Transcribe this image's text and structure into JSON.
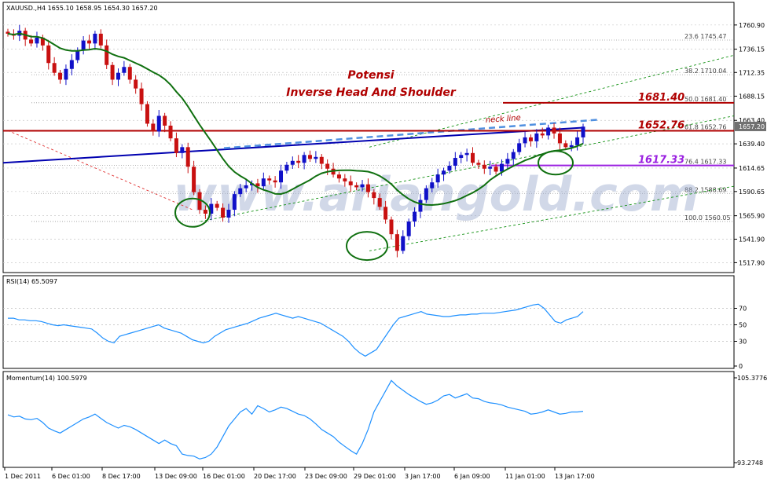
{
  "chart_data": [
    {
      "type": "candlestick",
      "header": "XAUUSD.,H4  1655.10 1658.95 1654.30 1657.20",
      "title_line1": "Potensi",
      "title_line2": "Inverse Head And Shoulder",
      "watermark": "www.ariangold.com",
      "neckline_label": "neck line",
      "ylim": [
        1511,
        1772
      ],
      "y_ticks": [
        "1760.90",
        "1736.15",
        "1712.35",
        "1688.15",
        "1663.40",
        "1639.40",
        "1614.65",
        "1590.65",
        "1565.90",
        "1541.90",
        "1517.90"
      ],
      "current_price": "1657.20",
      "levels": [
        {
          "value": 1681.4,
          "label": "1681.40",
          "color": "#b00000"
        },
        {
          "value": 1652.76,
          "label": "1652.76",
          "color": "#b00000"
        },
        {
          "value": 1617.33,
          "label": "1617.33",
          "color": "#9a20e0"
        }
      ],
      "fib_levels": [
        {
          "value": 1745.47,
          "pct": "23.6",
          "price": "1745.47"
        },
        {
          "value": 1710.04,
          "pct": "38.2",
          "price": "1710.04"
        },
        {
          "value": 1681.4,
          "pct": "50.0",
          "price": "1681.40"
        },
        {
          "value": 1652.76,
          "pct": "61.8",
          "price": "1652.76"
        },
        {
          "value": 1617.33,
          "pct": "76.4",
          "price": "1617.33"
        },
        {
          "value": 1588.69,
          "pct": "88.2",
          "price": "1588.69"
        },
        {
          "value": 1560.05,
          "pct": "100.0",
          "price": "1560.05"
        }
      ],
      "close_series": [
        1752,
        1750,
        1755,
        1746,
        1742,
        1748,
        1740,
        1722,
        1712,
        1705,
        1716,
        1725,
        1735,
        1745,
        1742,
        1752,
        1740,
        1720,
        1705,
        1712,
        1718,
        1705,
        1696,
        1680,
        1660,
        1652,
        1668,
        1658,
        1645,
        1630,
        1636,
        1616,
        1590,
        1572,
        1568,
        1578,
        1574,
        1564,
        1572,
        1588,
        1594,
        1597,
        1599,
        1596,
        1604,
        1602,
        1600,
        1612,
        1618,
        1622,
        1620,
        1628,
        1624,
        1626,
        1619,
        1614,
        1608,
        1604,
        1601,
        1597,
        1595,
        1598,
        1590,
        1584,
        1575,
        1562,
        1547,
        1530,
        1545,
        1560,
        1570,
        1582,
        1594,
        1600,
        1608,
        1612,
        1617,
        1625,
        1628,
        1630,
        1620,
        1618,
        1614,
        1616,
        1611,
        1619,
        1624,
        1631,
        1640,
        1646,
        1642,
        1650,
        1648,
        1656,
        1650,
        1640,
        1636,
        1638,
        1646,
        1657
      ]
    },
    {
      "type": "line",
      "label": "RSI(14) 65.5097",
      "ylim": [
        0,
        100
      ],
      "y_ticks": [
        "70",
        "50",
        "30",
        "0"
      ],
      "values": [
        58,
        58,
        56,
        56,
        55,
        55,
        54,
        52,
        50,
        49,
        50,
        49,
        48,
        47,
        46,
        45,
        40,
        34,
        30,
        28,
        36,
        38,
        40,
        42,
        44,
        46,
        48,
        50,
        46,
        44,
        42,
        40,
        36,
        32,
        30,
        28,
        30,
        36,
        40,
        44,
        46,
        48,
        50,
        52,
        55,
        58,
        60,
        62,
        64,
        62,
        60,
        58,
        60,
        58,
        56,
        54,
        52,
        48,
        44,
        40,
        36,
        30,
        22,
        16,
        12,
        16,
        20,
        30,
        40,
        50,
        58,
        60,
        62,
        64,
        66,
        63,
        62,
        61,
        60,
        60,
        61,
        62,
        62,
        63,
        63,
        64,
        64,
        64,
        65,
        66,
        67,
        68,
        70,
        72,
        74,
        75,
        70,
        62,
        54,
        52,
        56,
        58,
        60,
        66
      ]
    },
    {
      "type": "line",
      "label": "Momentum(14) 100.5979",
      "ylim": [
        93.2748,
        105.3776
      ],
      "y_ticks": [
        "105.3776",
        "93.2748"
      ],
      "values": [
        100.1,
        99.8,
        99.9,
        99.5,
        99.4,
        99.6,
        99.0,
        98.2,
        97.8,
        97.5,
        98.0,
        98.5,
        99.0,
        99.5,
        99.8,
        100.2,
        99.6,
        99.0,
        98.6,
        98.2,
        98.6,
        98.4,
        98.0,
        97.5,
        97.0,
        96.5,
        96.0,
        96.5,
        96.0,
        95.7,
        94.5,
        94.3,
        94.2,
        93.8,
        94.0,
        94.5,
        95.5,
        97.0,
        98.5,
        99.5,
        100.5,
        101.0,
        100.2,
        101.4,
        101.0,
        100.5,
        100.8,
        101.2,
        101.0,
        100.6,
        100.2,
        100.0,
        99.5,
        98.8,
        98.0,
        97.5,
        97.0,
        96.2,
        95.6,
        95.0,
        94.5,
        96.0,
        98.0,
        100.5,
        102.0,
        103.5,
        105.0,
        104.2,
        103.6,
        103.0,
        102.5,
        102.0,
        101.6,
        101.8,
        102.2,
        102.8,
        103.0,
        102.5,
        102.8,
        103.1,
        102.5,
        102.4,
        102.0,
        101.8,
        101.7,
        101.5,
        101.2,
        101.0,
        100.8,
        100.6,
        100.2,
        100.3,
        100.5,
        100.8,
        100.5,
        100.2,
        100.3,
        100.5,
        100.5,
        100.6
      ]
    }
  ],
  "x_ticks": [
    "1 Dec 2011",
    "6 Dec 01:00",
    "8 Dec 17:00",
    "13 Dec 09:00",
    "16 Dec 01:00",
    "20 Dec 17:00",
    "23 Dec 09:00",
    "29 Dec 01:00",
    "3 Jan 17:00",
    "6 Jan 09:00",
    "11 Jan 01:00",
    "13 Jan 17:00"
  ],
  "colors": {
    "up_candle": "#1010c8",
    "down_candle": "#c81010",
    "ma": "#107010",
    "trendline": "#0000b0",
    "neckline": "#5090e0",
    "channel": "#109010",
    "indicator": "#1e90ff",
    "circle": "#107010",
    "current_price_bg": "#707070"
  }
}
